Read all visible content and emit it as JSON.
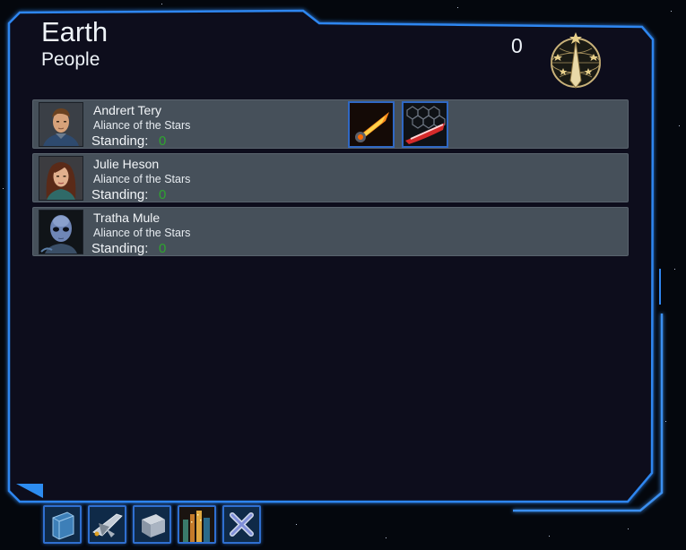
{
  "header": {
    "planet": "Earth",
    "section": "People",
    "score": "0"
  },
  "people": [
    {
      "name": "Andrert Tery",
      "faction": "Aliance of the Stars",
      "standing_label": "Standing:",
      "standing_value": "0",
      "portrait": "human-male-portrait",
      "abilities": [
        "flame-blast-icon",
        "hex-shield-slash-icon"
      ]
    },
    {
      "name": "Julie Heson",
      "faction": "Aliance of the Stars",
      "standing_label": "Standing:",
      "standing_value": "0",
      "portrait": "human-female-portrait",
      "abilities": []
    },
    {
      "name": "Tratha Mule",
      "faction": "Aliance of the Stars",
      "standing_label": "Standing:",
      "standing_value": "0",
      "portrait": "alien-portrait",
      "abilities": []
    }
  ],
  "toolbar": [
    "journal-book-icon",
    "starship-icon",
    "cargo-crate-icon",
    "city-planet-icon",
    "close-icon"
  ],
  "colors": {
    "frame_glow": "#3d9bff",
    "panel_bg": "#09111c",
    "row_bg": "#46505a",
    "standing_positive": "#2fa52f"
  }
}
